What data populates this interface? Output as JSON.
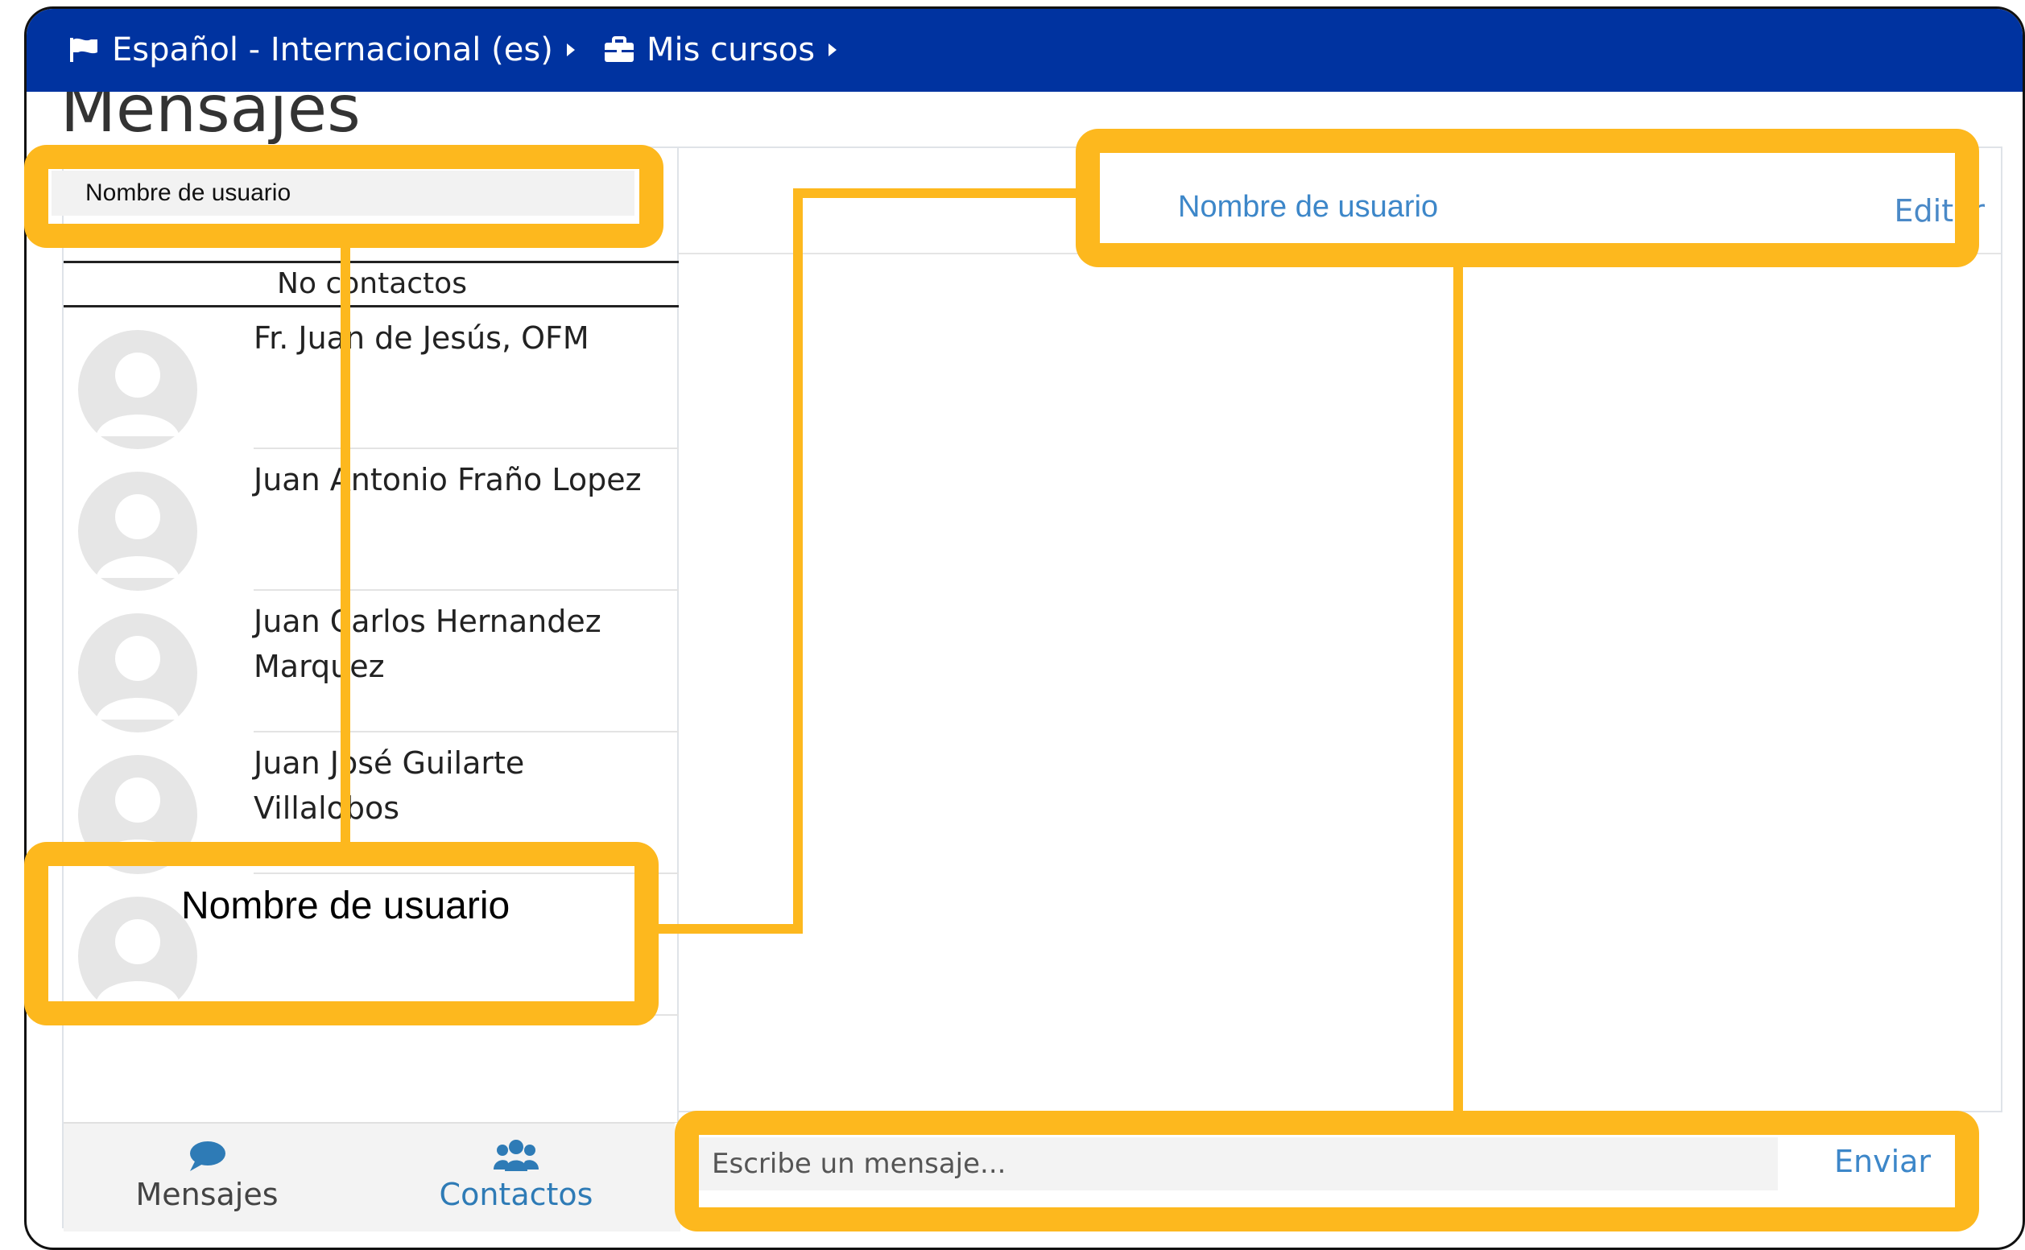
{
  "navbar": {
    "language_label": "Español - Internacional (es)",
    "courses_label": "Mis cursos",
    "background": "#0033a0"
  },
  "page": {
    "title": "Mensajes"
  },
  "sidebar": {
    "search_value": "Nombre de usuario",
    "header": "No contactos",
    "contacts": [
      {
        "name": "Fr. Juan de Jesús, OFM"
      },
      {
        "name": "Juan Antonio Fraño Lopez"
      },
      {
        "name": "Juan Carlos Hernandez Marquez"
      },
      {
        "name": "Juan José Guilarte Villalobos"
      },
      {
        "name": ""
      }
    ],
    "tabs": {
      "messages": "Mensajes",
      "contacts": "Contactos"
    }
  },
  "conversation": {
    "user_name": "Nombre de usuario",
    "edit_label": "Editar",
    "compose_placeholder": "Escribe un mensaje...",
    "send_label": "Enviar"
  },
  "annotations": {
    "callout_label": "Nombre de usuario",
    "highlight_color": "#fdb81e"
  }
}
